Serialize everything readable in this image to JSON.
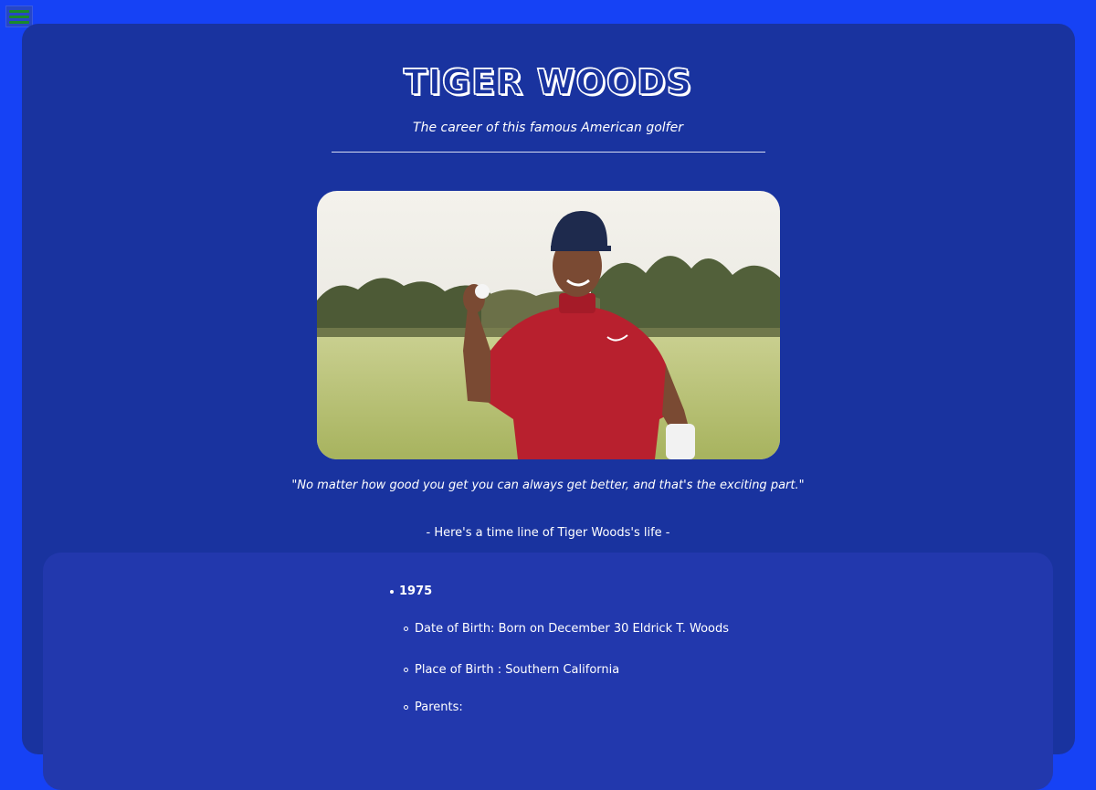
{
  "header": {
    "title": "TIGER WOODS",
    "subtitle": "The career of this famous American golfer"
  },
  "menu": {
    "icon": "hamburger-menu-icon",
    "color": "#1a8a2a"
  },
  "photo": {
    "subject": "golfer in red shirt and navy cap holding a golf ball"
  },
  "quote": "\"No matter how good you get you can always get better, and that's the exciting part.\"",
  "timeline": {
    "intro": "- Here's a time line of Tiger Woods's life -",
    "year": "1975",
    "items": [
      "Date of Birth: Born on December 30 Eldrick T. Woods",
      "Place of Birth : Southern California",
      "Parents:"
    ]
  },
  "colors": {
    "page_background": "#1642f5",
    "card_background": "#19339f",
    "panel_background": "#2238ad",
    "text": "#ffffff"
  }
}
